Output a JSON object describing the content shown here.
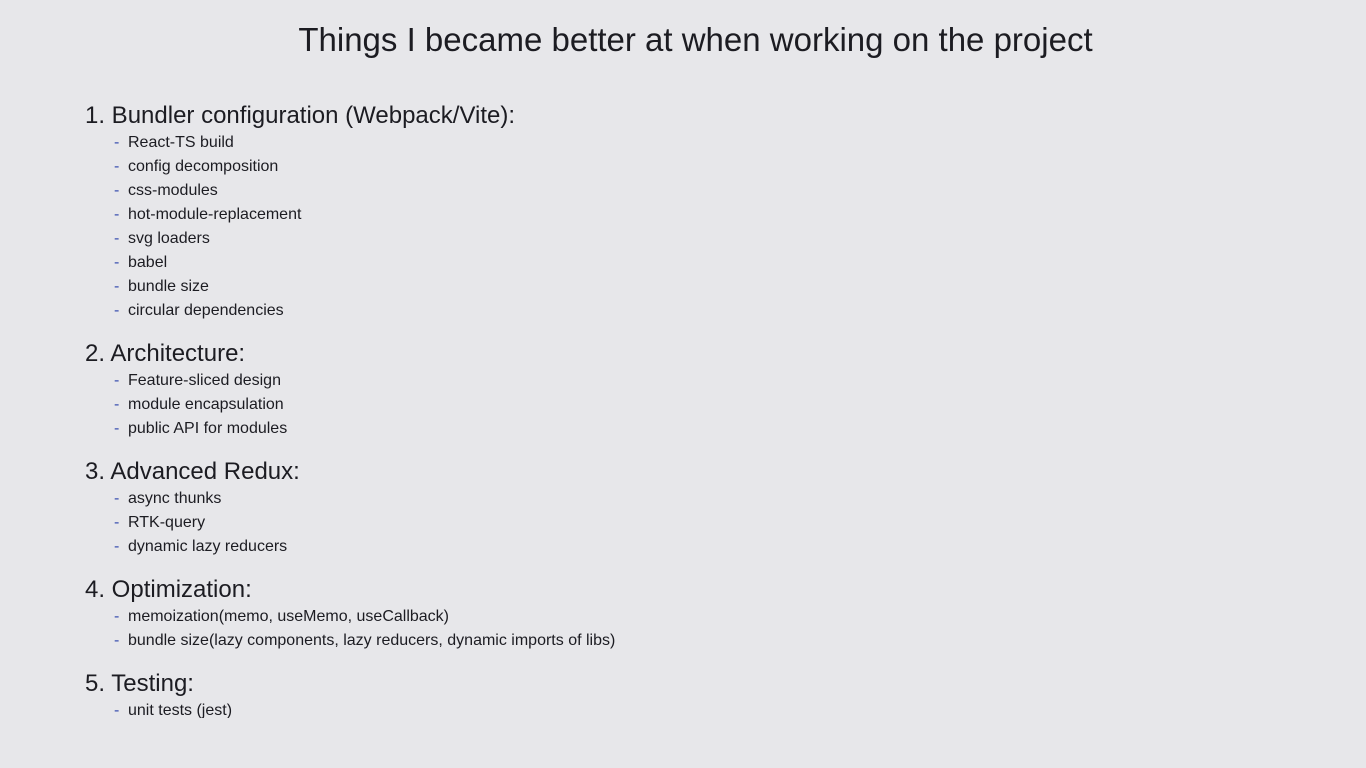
{
  "title": "Things I became better at when working on the project",
  "sections": [
    {
      "heading": "1. Bundler configuration (Webpack/Vite):",
      "items": [
        "React-TS build",
        "config decomposition",
        "css-modules",
        "hot-module-replacement",
        "svg loaders",
        "babel",
        "bundle size",
        "circular dependencies"
      ]
    },
    {
      "heading": "2. Architecture:",
      "items": [
        "Feature-sliced design",
        "module encapsulation",
        "public API for modules"
      ]
    },
    {
      "heading": "3. Advanced Redux:",
      "items": [
        "async thunks",
        "RTK-query",
        "dynamic lazy reducers"
      ]
    },
    {
      "heading": "4. Optimization:",
      "items": [
        "memoization(memo, useMemo, useCallback)",
        "bundle size(lazy components, lazy reducers, dynamic imports of libs)"
      ]
    },
    {
      "heading": "5. Testing:",
      "items": [
        "unit tests (jest)"
      ]
    }
  ],
  "bullet": "-"
}
